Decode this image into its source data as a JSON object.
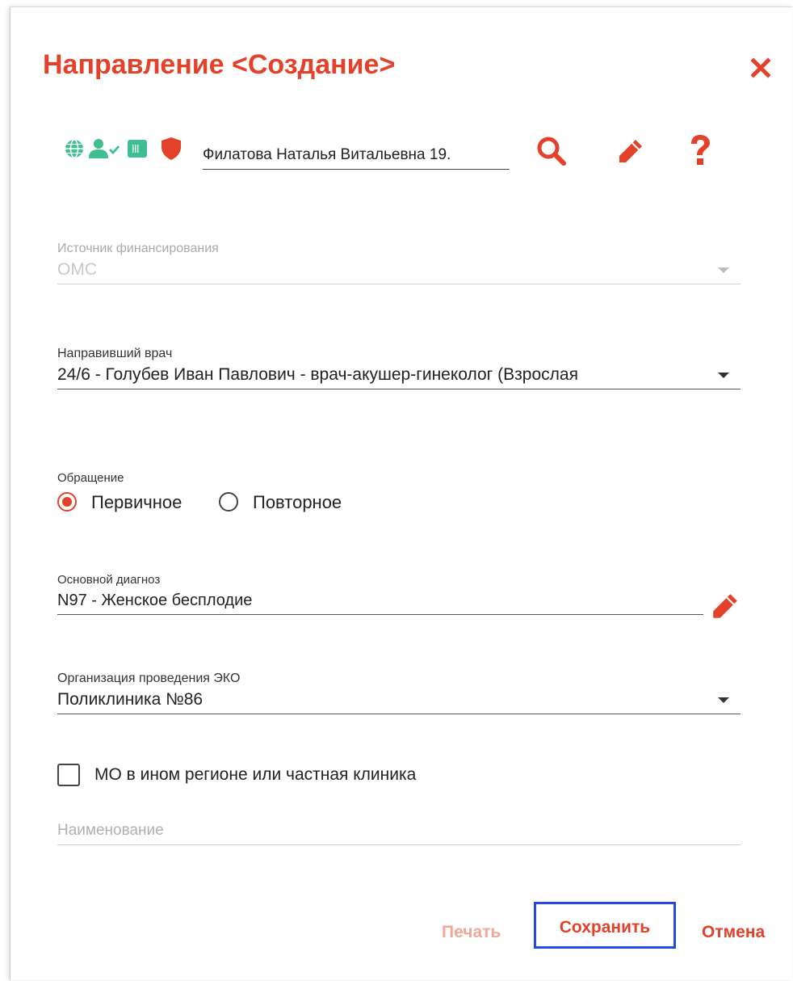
{
  "dialog": {
    "title": "Направление <Создание>",
    "close_icon": "close-icon"
  },
  "patient": {
    "value": "Филатова Наталья Витальевна 19.",
    "status_icons": [
      "globe-icon",
      "user-check-icon",
      "barcode-card-icon",
      "shield-icon"
    ],
    "actions": [
      "search-icon",
      "pencil-icon",
      "help-icon"
    ]
  },
  "funding": {
    "label": "Источник финансирования",
    "value": "ОМС",
    "disabled": true
  },
  "doctor": {
    "label": "Направивший врач",
    "value": "24/6 - Голубев Иван Павлович - врач-акушер-гинеколог (Взрослая"
  },
  "visit": {
    "label": "Обращение",
    "options": [
      {
        "label": "Первичное",
        "selected": true
      },
      {
        "label": "Повторное",
        "selected": false
      }
    ]
  },
  "diagnosis": {
    "label": "Основной диагноз",
    "value": "N97 - Женское бесплодие"
  },
  "eco_org": {
    "label": "Организация проведения ЭКО",
    "value": "Поликлиника №86"
  },
  "other_region": {
    "label": "МО в ином регионе или частная клиника",
    "checked": false
  },
  "name_field": {
    "placeholder": "Наименование"
  },
  "footer": {
    "print_label": "Печать",
    "save_label": "Сохранить",
    "cancel_label": "Отмена"
  },
  "colors": {
    "accent": "#e4412b",
    "teal": "#3fbf8f",
    "focus": "#2448e0"
  }
}
